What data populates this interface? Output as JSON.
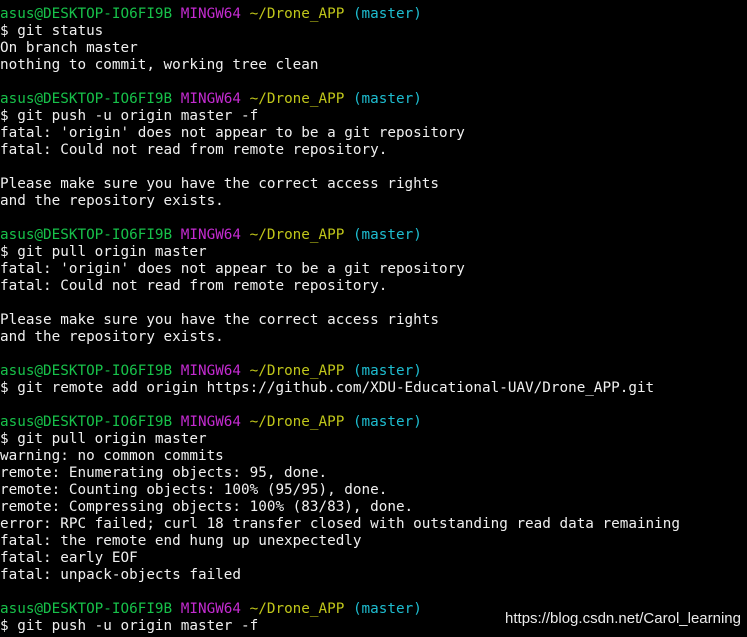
{
  "terminal": {
    "colors": {
      "background": "#000000",
      "text": "#f0f0f0",
      "user_host": "#17c14a",
      "mingw": "#c32bd0",
      "path": "#c0c61a",
      "branch": "#1ebdd0"
    },
    "prompt": {
      "user_host": "asus@DESKTOP-IO6FI9B",
      "system": "MINGW64",
      "path": "~/Drone_APP",
      "branch": "(master)"
    },
    "lines": [
      {
        "type": "prompt"
      },
      {
        "type": "text",
        "text": "$ git status"
      },
      {
        "type": "text",
        "text": "On branch master"
      },
      {
        "type": "text",
        "text": "nothing to commit, working tree clean"
      },
      {
        "type": "blank"
      },
      {
        "type": "prompt"
      },
      {
        "type": "text",
        "text": "$ git push -u origin master -f"
      },
      {
        "type": "text",
        "text": "fatal: 'origin' does not appear to be a git repository"
      },
      {
        "type": "text",
        "text": "fatal: Could not read from remote repository."
      },
      {
        "type": "blank"
      },
      {
        "type": "text",
        "text": "Please make sure you have the correct access rights"
      },
      {
        "type": "text",
        "text": "and the repository exists."
      },
      {
        "type": "blank"
      },
      {
        "type": "prompt"
      },
      {
        "type": "text",
        "text": "$ git pull origin master"
      },
      {
        "type": "text",
        "text": "fatal: 'origin' does not appear to be a git repository"
      },
      {
        "type": "text",
        "text": "fatal: Could not read from remote repository."
      },
      {
        "type": "blank"
      },
      {
        "type": "text",
        "text": "Please make sure you have the correct access rights"
      },
      {
        "type": "text",
        "text": "and the repository exists."
      },
      {
        "type": "blank"
      },
      {
        "type": "prompt"
      },
      {
        "type": "text",
        "text": "$ git remote add origin https://github.com/XDU-Educational-UAV/Drone_APP.git"
      },
      {
        "type": "blank"
      },
      {
        "type": "prompt"
      },
      {
        "type": "text",
        "text": "$ git pull origin master"
      },
      {
        "type": "text",
        "text": "warning: no common commits"
      },
      {
        "type": "text",
        "text": "remote: Enumerating objects: 95, done."
      },
      {
        "type": "text",
        "text": "remote: Counting objects: 100% (95/95), done."
      },
      {
        "type": "text",
        "text": "remote: Compressing objects: 100% (83/83), done."
      },
      {
        "type": "text",
        "text": "error: RPC failed; curl 18 transfer closed with outstanding read data remaining"
      },
      {
        "type": "text",
        "text": "fatal: the remote end hung up unexpectedly"
      },
      {
        "type": "text",
        "text": "fatal: early EOF"
      },
      {
        "type": "text",
        "text": "fatal: unpack-objects failed"
      },
      {
        "type": "blank"
      },
      {
        "type": "prompt"
      },
      {
        "type": "text",
        "text": "$ git push -u origin master -f"
      }
    ]
  },
  "watermark": {
    "text": "https://blog.csdn.net/Carol_learning"
  }
}
